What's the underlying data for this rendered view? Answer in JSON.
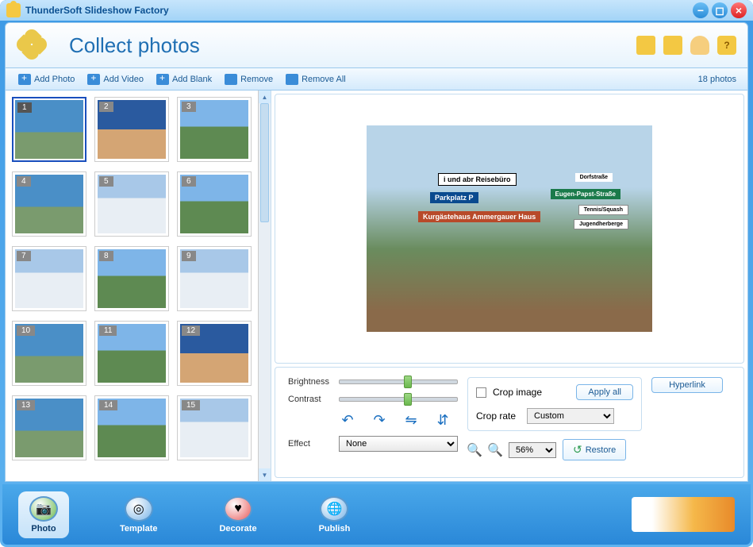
{
  "window": {
    "title": "ThunderSoft Slideshow Factory"
  },
  "header": {
    "title": "Collect photos"
  },
  "toolbar": {
    "add_photo": "Add Photo",
    "add_video": "Add Video",
    "add_blank": "Add Blank",
    "remove": "Remove",
    "remove_all": "Remove All",
    "count": "18 photos"
  },
  "thumbs": [
    {
      "n": "1"
    },
    {
      "n": "2"
    },
    {
      "n": "3"
    },
    {
      "n": "4"
    },
    {
      "n": "5"
    },
    {
      "n": "6"
    },
    {
      "n": "7"
    },
    {
      "n": "8"
    },
    {
      "n": "9"
    },
    {
      "n": "10"
    },
    {
      "n": "11"
    },
    {
      "n": "12"
    },
    {
      "n": "13"
    },
    {
      "n": "14"
    },
    {
      "n": "15"
    }
  ],
  "preview": {
    "signs": {
      "s1": "i  und abr Reisebüro",
      "s2": "Parkplatz  P",
      "s3": "Kurgästehaus Ammergauer Haus",
      "s4": "Eugen-Papst-Straße",
      "s5": "Tennis/Squash",
      "s6": "Jugendherberge",
      "s7": "Dorfstraße"
    }
  },
  "controls": {
    "brightness_label": "Brightness",
    "contrast_label": "Contrast",
    "effect_label": "Effect",
    "effect_value": "None",
    "crop_image_label": "Crop image",
    "apply_all": "Apply all",
    "crop_rate_label": "Crop rate",
    "crop_rate_value": "Custom",
    "zoom_value": "56%",
    "restore": "Restore",
    "hyperlink": "Hyperlink"
  },
  "tabs": {
    "photo": "Photo",
    "template": "Template",
    "decorate": "Decorate",
    "publish": "Publish"
  }
}
